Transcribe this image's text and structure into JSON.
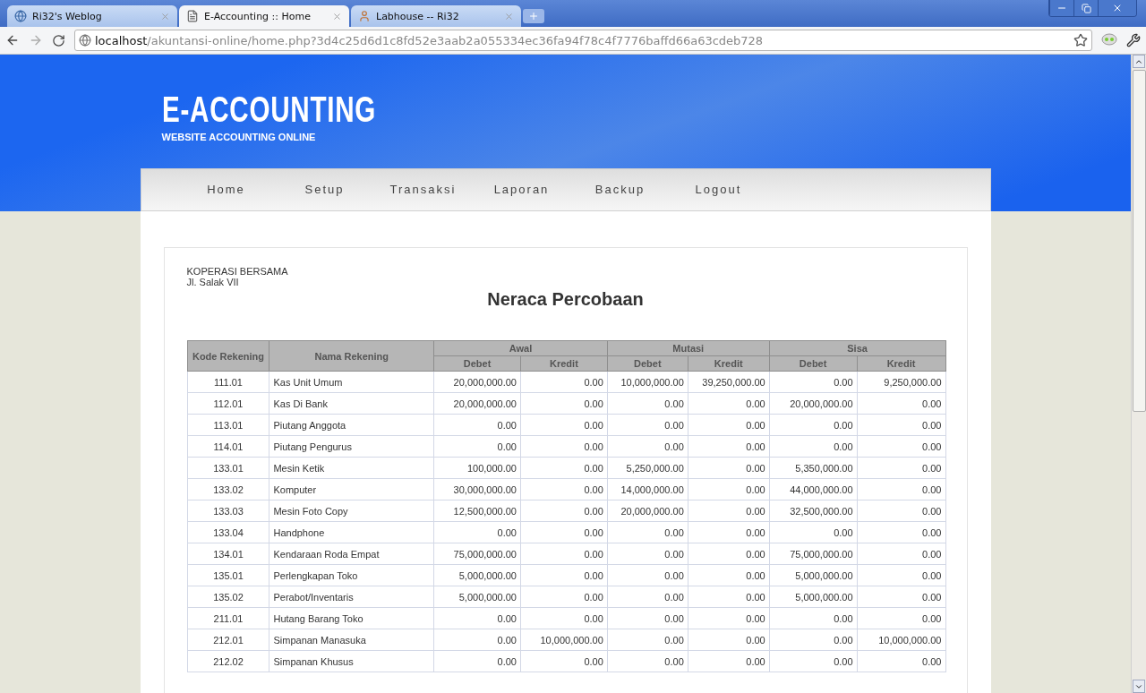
{
  "browser": {
    "tabs": [
      {
        "title": "Ri32's Weblog",
        "selected": false
      },
      {
        "title": "E-Accounting :: Home",
        "selected": true
      },
      {
        "title": "Labhouse -- Ri32",
        "selected": false
      }
    ],
    "address": {
      "host": "localhost",
      "path": "/akuntansi-online/home.php?3d4c25d6d1c8fd52e3aab2a055334ec36fa94f78c4f7776baffd66a63cdeb728"
    }
  },
  "site": {
    "title": "E-ACCOUNTING",
    "subtitle": "WEBSITE ACCOUNTING ONLINE"
  },
  "nav": [
    "Home",
    "Setup",
    "Transaksi",
    "Laporan",
    "Backup",
    "Logout"
  ],
  "report": {
    "company": "KOPERASI BERSAMA",
    "address": "Jl. Salak VII",
    "title": "Neraca Percobaan",
    "columns": {
      "code": "Kode Rekening",
      "name": "Nama Rekening",
      "groups": [
        "Awal",
        "Mutasi",
        "Sisa"
      ],
      "sub": [
        "Debet",
        "Kredit",
        "Debet",
        "Kredit",
        "Debet",
        "Kredit"
      ]
    },
    "rows": [
      {
        "code": "111.01",
        "name": "Kas Unit Umum",
        "values": [
          "20,000,000.00",
          "0.00",
          "10,000,000.00",
          "39,250,000.00",
          "0.00",
          "9,250,000.00"
        ]
      },
      {
        "code": "112.01",
        "name": "Kas Di Bank",
        "values": [
          "20,000,000.00",
          "0.00",
          "0.00",
          "0.00",
          "20,000,000.00",
          "0.00"
        ]
      },
      {
        "code": "113.01",
        "name": "Piutang Anggota",
        "values": [
          "0.00",
          "0.00",
          "0.00",
          "0.00",
          "0.00",
          "0.00"
        ]
      },
      {
        "code": "114.01",
        "name": "Piutang Pengurus",
        "values": [
          "0.00",
          "0.00",
          "0.00",
          "0.00",
          "0.00",
          "0.00"
        ]
      },
      {
        "code": "133.01",
        "name": "Mesin Ketik",
        "values": [
          "100,000.00",
          "0.00",
          "5,250,000.00",
          "0.00",
          "5,350,000.00",
          "0.00"
        ]
      },
      {
        "code": "133.02",
        "name": "Komputer",
        "values": [
          "30,000,000.00",
          "0.00",
          "14,000,000.00",
          "0.00",
          "44,000,000.00",
          "0.00"
        ]
      },
      {
        "code": "133.03",
        "name": "Mesin Foto Copy",
        "values": [
          "12,500,000.00",
          "0.00",
          "20,000,000.00",
          "0.00",
          "32,500,000.00",
          "0.00"
        ]
      },
      {
        "code": "133.04",
        "name": "Handphone",
        "values": [
          "0.00",
          "0.00",
          "0.00",
          "0.00",
          "0.00",
          "0.00"
        ]
      },
      {
        "code": "134.01",
        "name": "Kendaraan Roda Empat",
        "values": [
          "75,000,000.00",
          "0.00",
          "0.00",
          "0.00",
          "75,000,000.00",
          "0.00"
        ]
      },
      {
        "code": "135.01",
        "name": "Perlengkapan Toko",
        "values": [
          "5,000,000.00",
          "0.00",
          "0.00",
          "0.00",
          "5,000,000.00",
          "0.00"
        ]
      },
      {
        "code": "135.02",
        "name": "Perabot/Inventaris",
        "values": [
          "5,000,000.00",
          "0.00",
          "0.00",
          "0.00",
          "5,000,000.00",
          "0.00"
        ]
      },
      {
        "code": "211.01",
        "name": "Hutang Barang Toko",
        "values": [
          "0.00",
          "0.00",
          "0.00",
          "0.00",
          "0.00",
          "0.00"
        ]
      },
      {
        "code": "212.01",
        "name": "Simpanan Manasuka",
        "values": [
          "0.00",
          "10,000,000.00",
          "0.00",
          "0.00",
          "0.00",
          "10,000,000.00"
        ]
      },
      {
        "code": "212.02",
        "name": "Simpanan Khusus",
        "values": [
          "0.00",
          "0.00",
          "0.00",
          "0.00",
          "0.00",
          "0.00"
        ]
      }
    ]
  }
}
